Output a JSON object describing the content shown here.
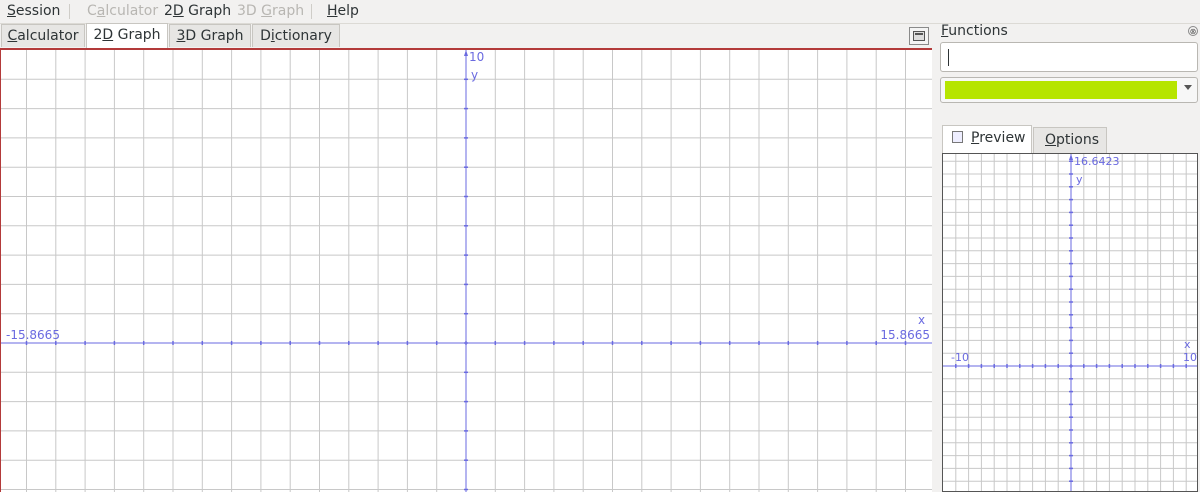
{
  "menubar": {
    "items": [
      {
        "label": "Session",
        "mnemonic": "S",
        "rest": "ession",
        "enabled": true
      },
      {
        "label": "Calculator",
        "enabled": false
      },
      {
        "label": "2D Graph",
        "enabled": true
      },
      {
        "label": "3D Graph",
        "enabled": false
      },
      {
        "label": "Help",
        "enabled": true
      }
    ]
  },
  "tabs": {
    "calculator": {
      "pre": "",
      "mn": "C",
      "post": "alculator"
    },
    "graph2d": {
      "pre": "2",
      "mn": "D",
      "post": " Graph"
    },
    "graph3d": {
      "pre": "",
      "mn": "3",
      "post": "D Graph"
    },
    "dictionary": {
      "pre": "D",
      "mn": "i",
      "post": "ctionary"
    }
  },
  "graph": {
    "x_min_label": "-15.8665",
    "x_max_label": "15.8665",
    "y_max_label": "10",
    "x_axis_name": "x",
    "y_axis_name": "y",
    "axis_color": "#6a6ae0",
    "grid_color": "#c8c8c8"
  },
  "dock": {
    "title_mn": "F",
    "title_rest": "unctions",
    "function_input_value": "",
    "selected_color": "#b6e500",
    "tabs": {
      "preview": {
        "mn": "P",
        "rest": "review"
      },
      "options": {
        "mn": "O",
        "rest": "ptions"
      }
    }
  },
  "preview": {
    "x_min_label": "-10",
    "x_max_label": "10",
    "y_max_label": "16.6423",
    "x_axis_name": "x",
    "y_axis_name": "y"
  }
}
